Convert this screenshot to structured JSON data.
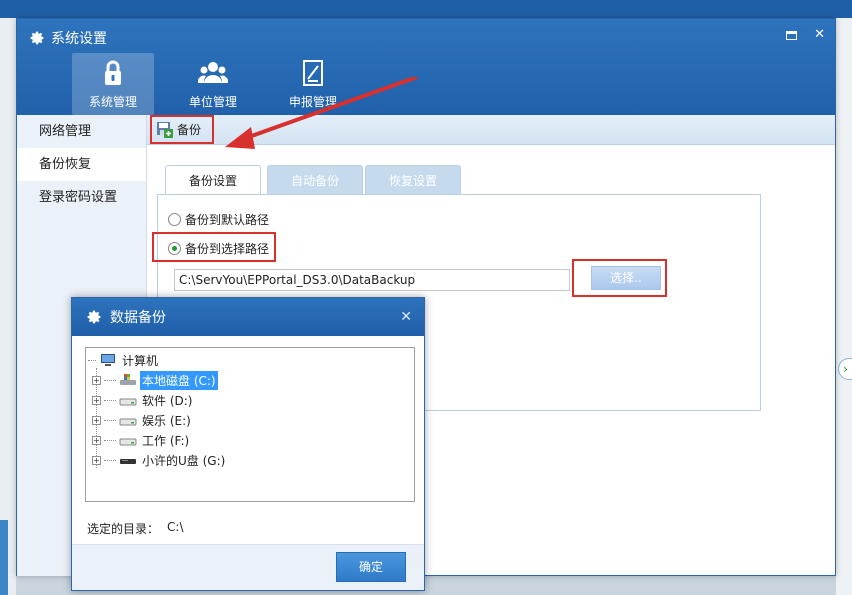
{
  "main": {
    "title": "系统设置",
    "top_tabs": [
      {
        "label": "系统管理",
        "icon": "lock-icon"
      },
      {
        "label": "单位管理",
        "icon": "users-icon"
      },
      {
        "label": "申报管理",
        "icon": "edit-document-icon"
      }
    ],
    "sidebar": [
      {
        "label": "网络管理"
      },
      {
        "label": "备份恢复"
      },
      {
        "label": "登录密码设置"
      }
    ],
    "toolbar": {
      "backup_label": "备份"
    },
    "content_tabs": [
      {
        "label": "备份设置"
      },
      {
        "label": "自动备份"
      },
      {
        "label": "恢复设置"
      }
    ],
    "options": {
      "default_path": "备份到默认路径",
      "select_path": "备份到选择路径"
    },
    "path_value": "C:\\ServYou\\EPPortal_DS3.0\\DataBackup",
    "select_button": "选择.."
  },
  "dialog": {
    "title": "数据备份",
    "tree_root": "计算机",
    "drives": [
      {
        "label": "本地磁盘 (C:)",
        "selected": true
      },
      {
        "label": "软件 (D:)"
      },
      {
        "label": "娱乐 (E:)"
      },
      {
        "label": "工作 (F:)"
      },
      {
        "label": "小许的U盘 (G:)"
      }
    ],
    "selected_label": "选定的目录：",
    "selected_value": "C:\\",
    "ok_button": "确定"
  },
  "colors": {
    "titlebar": "#1f5ea8",
    "highlight_red": "#d8302c",
    "selection_blue": "#3399ff"
  }
}
